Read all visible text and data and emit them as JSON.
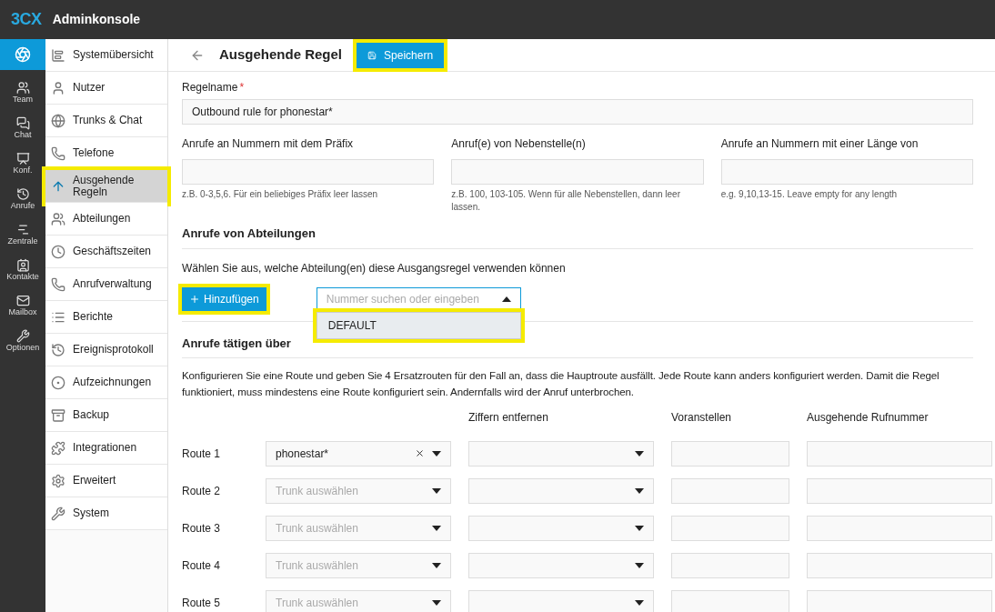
{
  "app": {
    "logo": "3CX",
    "title": "Adminkonsole"
  },
  "rail": [
    {
      "selected": true
    },
    {
      "label": "Team",
      "selected": false
    },
    {
      "label": "Chat",
      "selected": false
    },
    {
      "label": "Konf.",
      "selected": false
    },
    {
      "label": "Anrufe",
      "selected": false
    },
    {
      "label": "Zentrale",
      "selected": false
    },
    {
      "label": "Kontakte",
      "selected": false
    },
    {
      "label": "Mailbox",
      "selected": false
    },
    {
      "label": "Optionen",
      "selected": false
    }
  ],
  "sidebar": {
    "items": [
      {
        "label": "Systemübersicht",
        "selected": false,
        "highlighted": false
      },
      {
        "label": "Nutzer",
        "selected": false,
        "highlighted": false
      },
      {
        "label": "Trunks & Chat",
        "selected": false,
        "highlighted": false
      },
      {
        "label": "Telefone",
        "selected": false,
        "highlighted": false
      },
      {
        "label": "Ausgehende Regeln",
        "selected": true,
        "highlighted": true
      },
      {
        "label": "Abteilungen",
        "selected": false,
        "highlighted": false
      },
      {
        "label": "Geschäftszeiten",
        "selected": false,
        "highlighted": false
      },
      {
        "label": "Anrufverwaltung",
        "selected": false,
        "highlighted": false
      },
      {
        "label": "Berichte",
        "selected": false,
        "highlighted": false
      },
      {
        "label": "Ereignisprotokoll",
        "selected": false,
        "highlighted": false
      },
      {
        "label": "Aufzeichnungen",
        "selected": false,
        "highlighted": false
      },
      {
        "label": "Backup",
        "selected": false,
        "highlighted": false
      },
      {
        "label": "Integrationen",
        "selected": false,
        "highlighted": false
      },
      {
        "label": "Erweitert",
        "selected": false,
        "highlighted": false
      },
      {
        "label": "System",
        "selected": false,
        "highlighted": false
      }
    ]
  },
  "page": {
    "title": "Ausgehende Regel",
    "save": {
      "label": "Speichern",
      "highlighted": true
    }
  },
  "rule_name": {
    "label": "Regelname",
    "required_mark": "*",
    "value": "Outbound rule for phonestar*"
  },
  "criteria": [
    {
      "label": "Anrufe an Nummern mit dem Präfix",
      "hint": "z.B. 0-3,5,6. Für ein beliebiges Präfix leer lassen"
    },
    {
      "label": "Anruf(e) von Nebenstelle(n)",
      "hint": "z.B. 100, 103-105. Wenn für alle Nebenstellen, dann leer lassen."
    },
    {
      "label": "Anrufe an Nummern mit einer Länge von",
      "hint": "e.g. 9,10,13-15. Leave empty for any length"
    }
  ],
  "departments": {
    "heading": "Anrufe von Abteilungen",
    "description": "Wählen Sie aus, welche Abteilung(en) diese Ausgangsregel verwenden können",
    "add": {
      "label": "Hinzufügen",
      "highlighted": true
    },
    "search": {
      "placeholder": "Nummer suchen oder eingeben",
      "expanded": true
    },
    "options": [
      {
        "label": "DEFAULT",
        "highlighted": true
      }
    ]
  },
  "routes": {
    "heading": "Anrufe tätigen über",
    "description": "Konfigurieren Sie eine Route und geben Sie 4 Ersatzrouten für den Fall an, dass die Hauptroute ausfällt. Jede Route kann anders konfiguriert werden. Damit die Regel funktioniert, muss mindestens eine Route konfiguriert sein. Andernfalls wird der Anruf unterbrochen.",
    "columns": [
      "Ziffern entfernen",
      "Voranstellen",
      "Ausgehende Rufnummer"
    ],
    "rows": [
      {
        "label": "Route 1",
        "trunk": "phonestar*",
        "clearable": true
      },
      {
        "label": "Route 2",
        "trunk_placeholder": "Trunk auswählen",
        "clearable": false
      },
      {
        "label": "Route 3",
        "trunk_placeholder": "Trunk auswählen",
        "clearable": false
      },
      {
        "label": "Route 4",
        "trunk_placeholder": "Trunk auswählen",
        "clearable": false
      },
      {
        "label": "Route 5",
        "trunk_placeholder": "Trunk auswählen",
        "clearable": false
      }
    ]
  }
}
